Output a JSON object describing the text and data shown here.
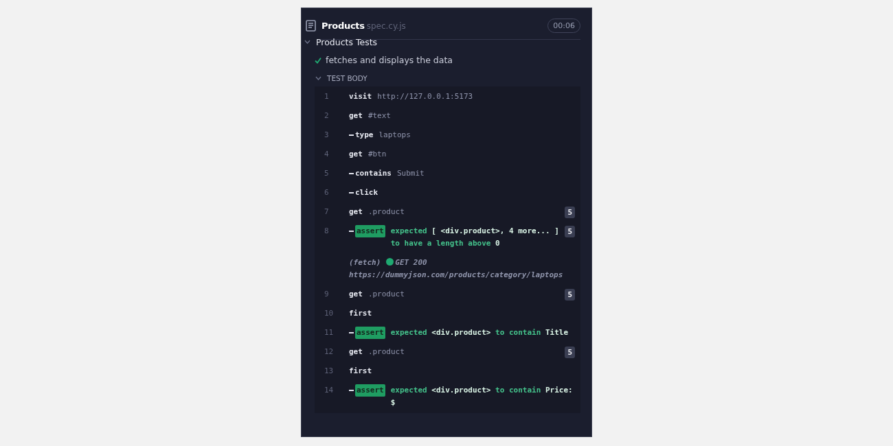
{
  "spec": {
    "name": "Products",
    "extension": "spec.cy.js",
    "duration": "00:06"
  },
  "suite": {
    "title": "Products Tests",
    "expanded": true
  },
  "test": {
    "title": "fetches and displays the data",
    "passed": true
  },
  "section": {
    "title": "TEST BODY",
    "expanded": true
  },
  "commands": [
    {
      "kind": "command",
      "number": "1",
      "child": false,
      "name": "visit",
      "message": "http://127.0.0.1:5173"
    },
    {
      "kind": "command",
      "number": "2",
      "child": false,
      "name": "get",
      "message": "#text"
    },
    {
      "kind": "command",
      "number": "3",
      "child": true,
      "name": "type",
      "message": "laptops"
    },
    {
      "kind": "command",
      "number": "4",
      "child": false,
      "name": "get",
      "message": "#btn"
    },
    {
      "kind": "command",
      "number": "5",
      "child": true,
      "name": "contains",
      "message": "Submit"
    },
    {
      "kind": "command",
      "number": "6",
      "child": true,
      "name": "click"
    },
    {
      "kind": "command",
      "number": "7",
      "child": false,
      "name": "get",
      "message": ".product",
      "badge": "5"
    },
    {
      "kind": "assert",
      "number": "8",
      "child": true,
      "name": "assert",
      "message": "expected **[ <div.product>, 4 more... ]** to have a length above **0**",
      "badge": "5"
    },
    {
      "kind": "fetch",
      "name": "(fetch)",
      "status": "GET 200",
      "message": "https://dummyjson.com/products/category/laptops"
    },
    {
      "kind": "command",
      "number": "9",
      "child": false,
      "name": "get",
      "message": ".product",
      "badge": "5"
    },
    {
      "kind": "command",
      "number": "10",
      "child": false,
      "name": "first"
    },
    {
      "kind": "assert",
      "number": "11",
      "child": true,
      "name": "assert",
      "message": "expected **<div.product>** to contain **Title**"
    },
    {
      "kind": "command",
      "number": "12",
      "child": false,
      "name": "get",
      "message": ".product",
      "badge": "5"
    },
    {
      "kind": "command",
      "number": "13",
      "child": false,
      "name": "first"
    },
    {
      "kind": "assert",
      "number": "14",
      "child": true,
      "name": "assert",
      "message": "expected **<div.product>** to contain **Price: $**"
    }
  ]
}
